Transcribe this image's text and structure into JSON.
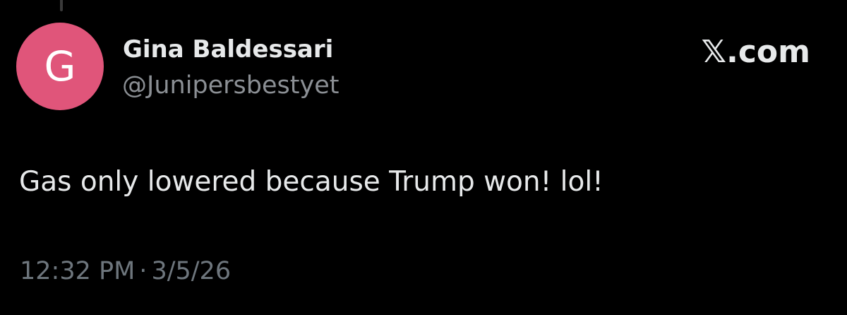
{
  "post": {
    "author": {
      "display_name": "Gina Baldessari",
      "handle": "@Junipersbestyet",
      "avatar_initial": "G",
      "avatar_color": "#e0557a"
    },
    "brand": "𝕏.com",
    "text": "Gas only lowered because Trump won! lol!",
    "time": "12:32 PM",
    "separator": "·",
    "date": "3/5/26"
  },
  "colors": {
    "background": "#000000",
    "primary_text": "#e7e9ea",
    "secondary_text": "#8b8f94"
  }
}
